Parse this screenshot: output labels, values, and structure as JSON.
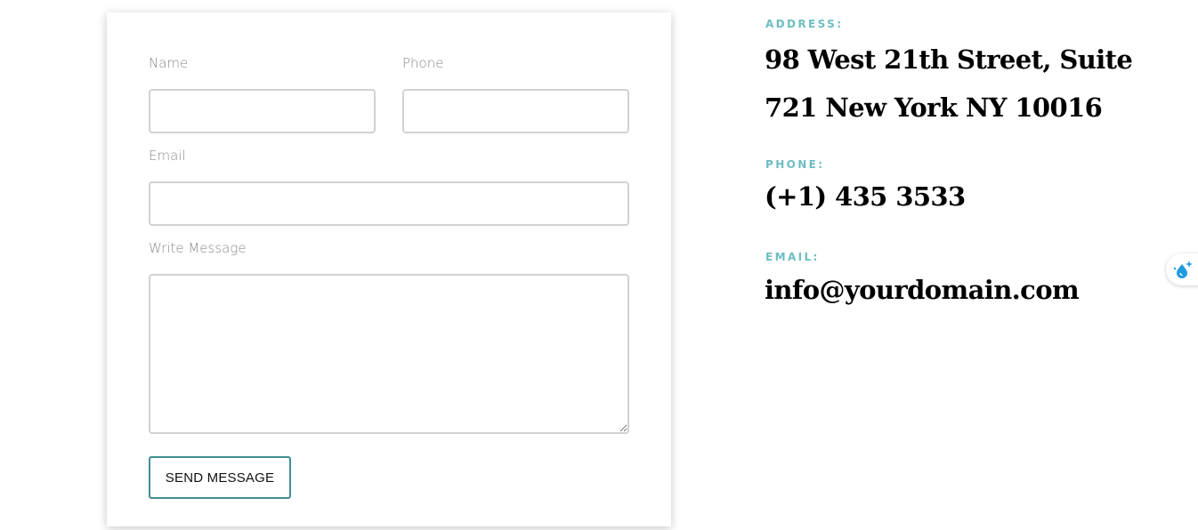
{
  "form": {
    "name_label": "Name",
    "phone_label": "Phone",
    "email_label": "Email",
    "message_label": "Write Message",
    "name_value": "",
    "phone_value": "",
    "email_value": "",
    "message_value": "",
    "submit_label": "SEND MESSAGE"
  },
  "contact": {
    "address_label": "ADDRESS:",
    "address_line1": "98 West 21th Street, Suite",
    "address_line2": "721 New York NY 10016",
    "phone_label": "PHONE:",
    "phone_value": "(+1) 435 3533",
    "email_label": "EMAIL:",
    "email_value": "info@yourdomain.com"
  },
  "side_widget": {
    "icon": "water-drop-sparkle-icon"
  },
  "colors": {
    "accent": "#6dbdc2",
    "button_border": "#3f8f94",
    "label": "#8a8a8a",
    "input_border": "#d2d2d2",
    "widget_icon": "#1e9be0"
  }
}
